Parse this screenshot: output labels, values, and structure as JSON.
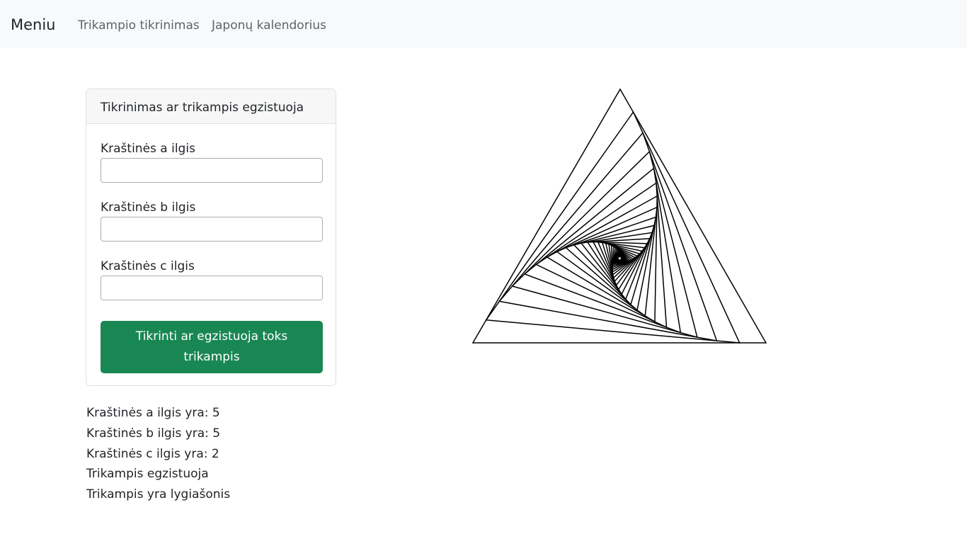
{
  "navbar": {
    "brand": "Meniu",
    "links": [
      {
        "label": "Trikampio tikrinimas"
      },
      {
        "label": "Japonų kalendorius"
      }
    ]
  },
  "form": {
    "title": "Tikrinimas ar trikampis egzistuoja",
    "fields": [
      {
        "label": "Kraštinės a ilgis",
        "value": ""
      },
      {
        "label": "Kraštinės b ilgis",
        "value": ""
      },
      {
        "label": "Kraštinės c ilgis",
        "value": ""
      }
    ],
    "submit_label": "Tikrinti ar egzistuoja toks trikampis"
  },
  "results": [
    "Kraštinės a ilgis yra: 5",
    "Kraštinės b ilgis yra: 5",
    "Kraštinės c ilgis yra: 2",
    "Trikampis egzistuoja",
    "Trikampis yra lygiašonis"
  ],
  "drawing": {
    "stroke_color": "#000000",
    "nested_triangles": 30,
    "step_fraction": 0.09
  }
}
